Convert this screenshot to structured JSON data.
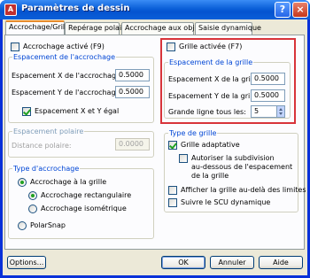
{
  "window": {
    "title": "Paramètres de dessin",
    "icon": "autocad-app-icon",
    "help_glyph": "?",
    "close_glyph": "×"
  },
  "tabs": [
    {
      "label": "Accrochage/Grille",
      "active": true
    },
    {
      "label": "Repérage polaire",
      "active": false
    },
    {
      "label": "Accrochage aux objets",
      "active": false
    },
    {
      "label": "Saisie dynamique",
      "active": false
    }
  ],
  "snap": {
    "enable_label": "Accrochage activé (F9)",
    "enable_checked": false,
    "spacing_title": "Espacement de l'accrochage",
    "x_label": "Espacement X de l'accrochage:",
    "x_value": "0.5000",
    "y_label": "Espacement Y de l'accrochage:",
    "y_value": "0.5000",
    "equal_label": "Espacement X et Y égal",
    "equal_checked": true
  },
  "polar": {
    "title": "Espacement polaire",
    "distance_label": "Distance polaire:",
    "distance_value": "0.0000"
  },
  "snap_type": {
    "title": "Type d'accrochage",
    "grid_snap_label": "Accrochage à la grille",
    "rect_label": "Accrochage rectangulaire",
    "iso_label": "Accrochage isométrique",
    "polar_label": "PolarSnap",
    "selected": "rect"
  },
  "grid": {
    "enable_label": "Grille activée (F7)",
    "enable_checked": false,
    "spacing_title": "Espacement de la grille",
    "x_label": "Espacement X de la grille:",
    "x_value": "0.5000",
    "y_label": "Espacement Y de la grille:",
    "y_value": "0.5000",
    "major_label": "Grande ligne tous les:",
    "major_value": "5"
  },
  "grid_type": {
    "title": "Type de grille",
    "adaptive_label": "Grille adaptative",
    "adaptive_checked": true,
    "subdivide_line1": "Autoriser la subdivision",
    "subdivide_line2": "au-dessous de l'espacement",
    "subdivide_line3": "de la grille",
    "subdivide_checked": false,
    "beyond_label": "Afficher la grille au-delà des limites",
    "beyond_checked": false,
    "follow_ucs_label": "Suivre le SCU dynamique",
    "follow_ucs_checked": false
  },
  "buttons": {
    "options": "Options...",
    "ok": "OK",
    "cancel": "Annuler",
    "help": "Aide"
  },
  "annotation_color": "#d8343a"
}
